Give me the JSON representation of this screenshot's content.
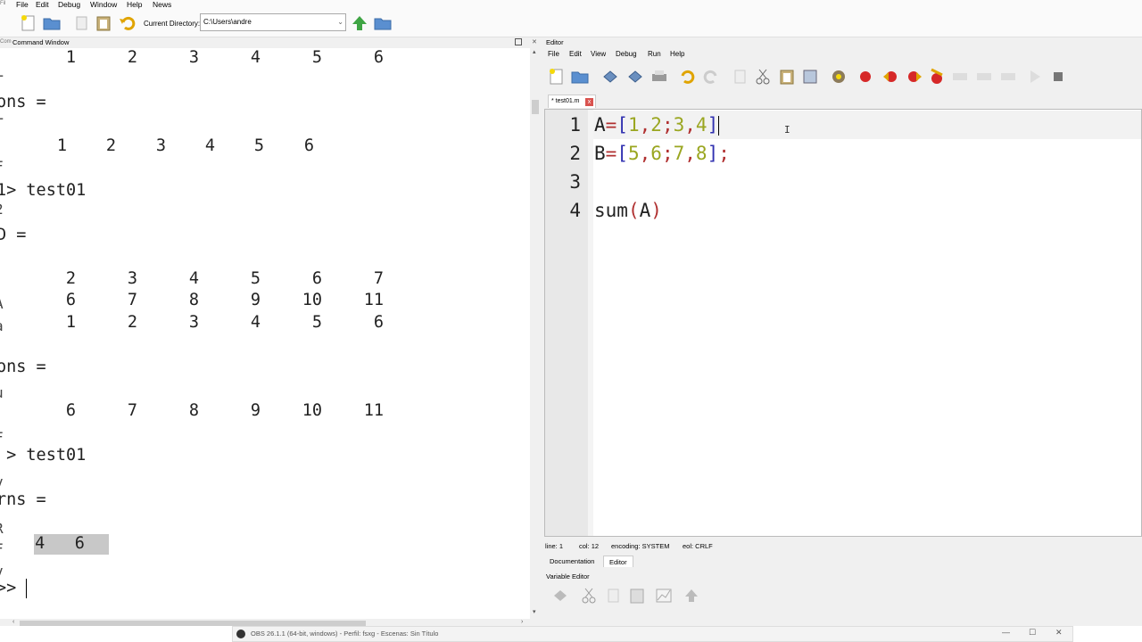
{
  "menubar": [
    "File",
    "Edit",
    "Debug",
    "Window",
    "Help",
    "News"
  ],
  "left_fragment": "Fil",
  "toolbar": {
    "current_directory_label": "Current Directory:",
    "current_directory_value": "C:\\Users\\andre"
  },
  "command_window": {
    "title": "Command Window",
    "title_fragment": "Com",
    "lines": [
      {
        "kind": "row",
        "cells": [
          "1",
          "2",
          "3",
          "4",
          "5",
          "6"
        ],
        "style": "wide"
      },
      {
        "kind": "text",
        "text": "ons ="
      },
      {
        "kind": "row",
        "cells": [
          "1",
          "2",
          "3",
          "4",
          "5",
          "6"
        ],
        "style": "narrow",
        "prefix": "r"
      },
      {
        "kind": "text",
        "text": "1> test01"
      },
      {
        "kind": "text",
        "text": "D ="
      },
      {
        "kind": "row",
        "cells": [
          "2",
          "3",
          "4",
          "5",
          "6",
          "7"
        ],
        "style": "wide"
      },
      {
        "kind": "row",
        "cells": [
          "6",
          "7",
          "8",
          "9",
          "10",
          "11"
        ],
        "style": "wide"
      },
      {
        "kind": "row",
        "cells": [
          "1",
          "2",
          "3",
          "4",
          "5",
          "6"
        ],
        "style": "wide"
      },
      {
        "kind": "text",
        "text": "ons ="
      },
      {
        "kind": "row",
        "cells": [
          "6",
          "7",
          "8",
          "9",
          "10",
          "11"
        ],
        "style": "wide"
      },
      {
        "kind": "text",
        "text": " > test01"
      },
      {
        "kind": "text",
        "text": "rns ="
      },
      {
        "kind": "highlight",
        "text": " 4   6 "
      },
      {
        "kind": "prompt",
        "text": ">> "
      }
    ],
    "left_clipped_glyphs": [
      "T",
      "T",
      "F",
      "2",
      "A",
      "a",
      "u",
      "F",
      "v",
      "R",
      "F",
      "v"
    ]
  },
  "editor": {
    "title": "Editor",
    "menu": [
      "File",
      "Edit",
      "View",
      "Debug",
      "Run",
      "Help"
    ],
    "tab_label": "* test01.m",
    "tab_close": "x",
    "lines": [
      {
        "num": "1",
        "tokens": [
          [
            "id",
            "A"
          ],
          [
            "op",
            "="
          ],
          [
            "br",
            "["
          ],
          [
            "num",
            "1"
          ],
          [
            "op",
            ","
          ],
          [
            "num",
            "2"
          ],
          [
            "op",
            ";"
          ],
          [
            "num",
            "3"
          ],
          [
            "op",
            ","
          ],
          [
            "num",
            "4"
          ],
          [
            "br",
            "]"
          ]
        ]
      },
      {
        "num": "2",
        "tokens": [
          [
            "id",
            "B"
          ],
          [
            "op",
            "="
          ],
          [
            "br",
            "["
          ],
          [
            "num",
            "5"
          ],
          [
            "op",
            ","
          ],
          [
            "num",
            "6"
          ],
          [
            "op",
            ";"
          ],
          [
            "num",
            "7"
          ],
          [
            "op",
            ","
          ],
          [
            "num",
            "8"
          ],
          [
            "br",
            "]"
          ],
          [
            "semi",
            ";"
          ]
        ]
      },
      {
        "num": "3",
        "tokens": []
      },
      {
        "num": "4",
        "tokens": [
          [
            "id",
            "sum"
          ],
          [
            "op",
            "("
          ],
          [
            "id",
            "A"
          ],
          [
            "op",
            ")"
          ]
        ]
      }
    ],
    "status": {
      "line": "line: 1",
      "col": "col: 12",
      "encoding": "encoding: SYSTEM",
      "eol": "eol: CRLF"
    },
    "bottom_tabs": [
      "Documentation",
      "Editor"
    ],
    "active_bottom_tab": "Editor",
    "variable_editor_label": "Variable Editor"
  },
  "taskbar": {
    "obs_title": "OBS 26.1.1 (64-bit, windows) - Perfil: fsxg - Escenas: Sin Título"
  },
  "colors": {
    "number": "#9aa620",
    "operator": "#b03030",
    "bracket": "#3030b0",
    "breakpoint": "#d62828"
  }
}
